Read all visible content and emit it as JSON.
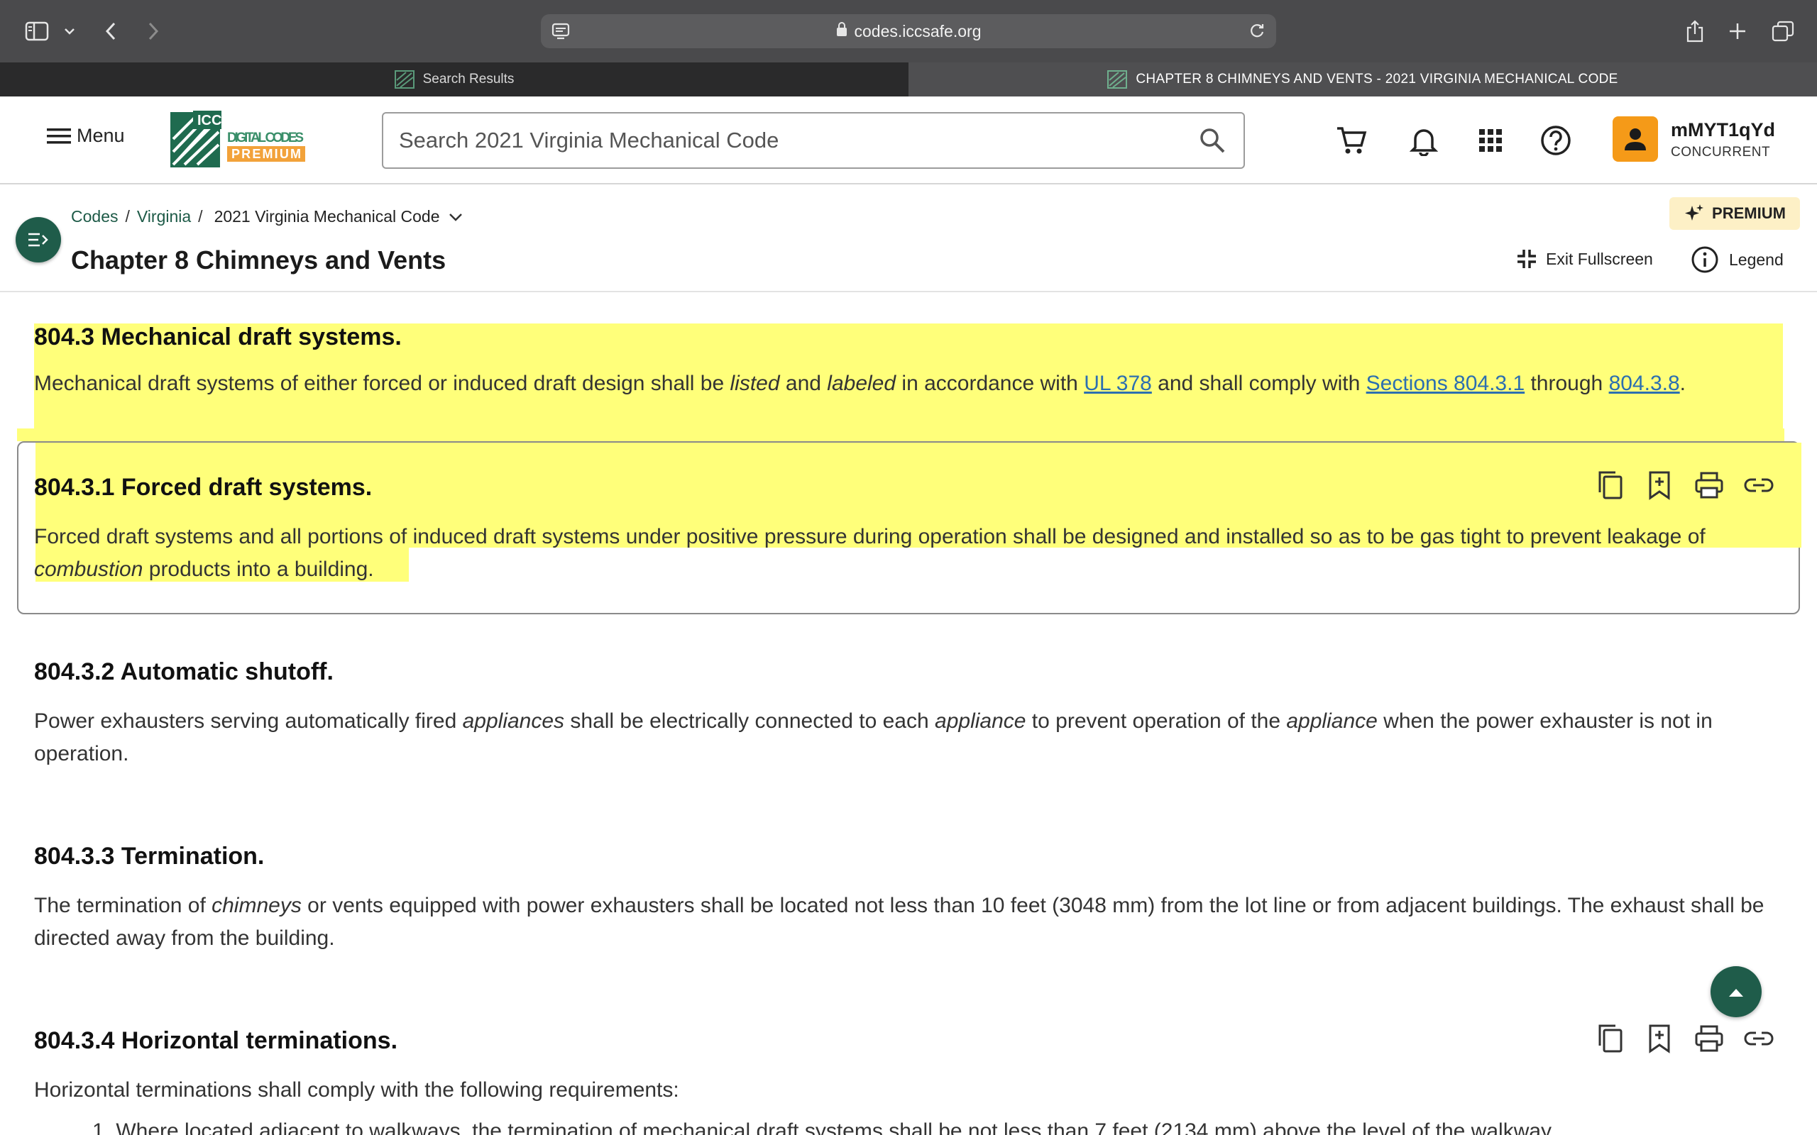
{
  "browser": {
    "url": "codes.iccsafe.org",
    "tabs": [
      {
        "label": "Search Results",
        "active": false
      },
      {
        "label": "CHAPTER 8 CHIMNEYS AND VENTS - 2021 VIRGINIA MECHANICAL CODE",
        "active": true
      }
    ]
  },
  "header": {
    "menu_label": "Menu",
    "search_placeholder": "Search 2021 Virginia Mechanical Code",
    "user": {
      "name": "mMYT1qYd",
      "role": "CONCURRENT"
    },
    "icons": [
      "cart-icon",
      "bell-icon",
      "apps-grid-icon",
      "help-icon"
    ]
  },
  "subheader": {
    "breadcrumb": {
      "codes": "Codes",
      "virginia": "Virginia",
      "current": "2021 Virginia Mechanical Code"
    },
    "title": "Chapter 8 Chimneys and Vents",
    "premium_label": "PREMIUM",
    "exit_fullscreen_label": "Exit Fullscreen",
    "legend_label": "Legend"
  },
  "sections": {
    "s8043": {
      "title": "804.3 Mechanical draft systems.",
      "t1": "Mechanical draft systems of either forced or induced draft design shall be ",
      "e1": "listed",
      "t2": " and ",
      "e2": "labeled",
      "t3": " in accordance with ",
      "l1": "UL 378",
      "t4": " and shall comply with ",
      "l2": "Sections 804.3.1",
      "t5": " through ",
      "l3": "804.3.8",
      "t6": "."
    },
    "s80431": {
      "title": "804.3.1 Forced draft systems.",
      "t1": "Forced draft systems and all portions of induced draft systems under positive pressure during operation shall be designed and installed so as to be gas tight to prevent leakage of ",
      "e1": "combustion",
      "t2": " products into a building."
    },
    "s80432": {
      "title": "804.3.2 Automatic shutoff.",
      "t1": "Power exhausters serving automatically fired ",
      "e1": "appliances",
      "t2": " shall be electrically connected to each ",
      "e2": "appliance",
      "t3": " to prevent operation of the ",
      "e3": "appliance",
      "t4": " when the power exhauster is not in operation."
    },
    "s80433": {
      "title": "804.3.3 Termination.",
      "t1": "The termination of ",
      "e1": "chimneys",
      "t2": " or vents equipped with power exhausters shall be located not less than 10 feet (3048 mm) from the lot line or from adjacent buildings. The exhaust shall be directed away from the building."
    },
    "s80434": {
      "title": "804.3.4 Horizontal terminations.",
      "t1": "Horizontal terminations shall comply with the following requirements:",
      "item1": "1. Where located adjacent to walkways, the termination of mechanical draft systems shall be not less than 7 feet (2134 mm) above the level of the walkway."
    }
  },
  "colors": {
    "highlight": "#ffff7a",
    "brand_green": "#1f5c4a",
    "link": "#2c6fb0",
    "avatar": "#f59a18",
    "premium_bg": "#fdf0c6"
  }
}
